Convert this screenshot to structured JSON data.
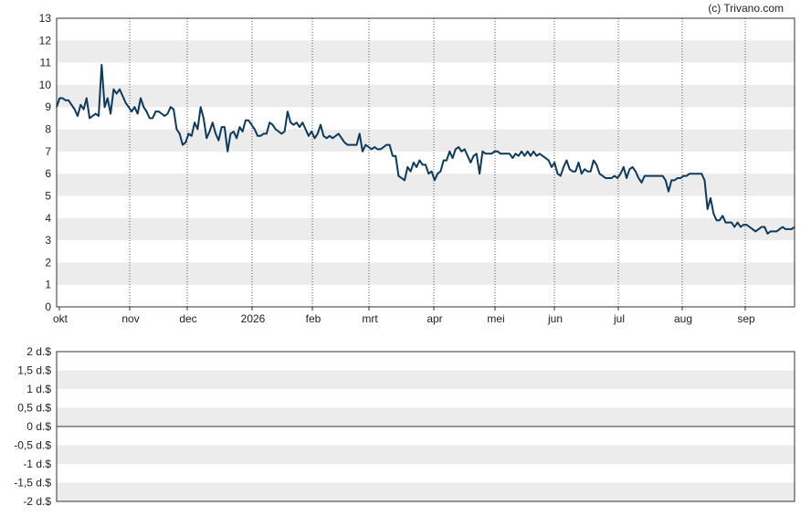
{
  "copyright": "(c) Trivano.com",
  "colors": {
    "line": "#0d3a5c",
    "band": "#ececec",
    "frame": "#333333",
    "zero_line": "#333333"
  },
  "chart_data": [
    {
      "type": "line",
      "title": "",
      "xlabel": "",
      "ylabel": "",
      "ylim": [
        0,
        13
      ],
      "yticks": [
        "0",
        "1",
        "2",
        "3",
        "4",
        "5",
        "6",
        "7",
        "8",
        "9",
        "10",
        "11",
        "12",
        "13"
      ],
      "x_ticks": [
        "okt",
        "nov",
        "dec",
        "2026",
        "feb",
        "mrt",
        "apr",
        "mei",
        "jun",
        "jul",
        "aug",
        "sep"
      ],
      "grid": "vertical dotted lines at month boundaries, alternating horizontal bands",
      "series": [
        {
          "values": [
            9.0,
            9.4,
            9.4,
            9.3,
            9.3,
            9.1,
            8.9,
            8.6,
            9.1,
            8.9,
            9.4,
            8.5,
            8.6,
            8.7,
            8.6,
            10.9,
            9.0,
            9.4,
            8.7,
            9.8,
            9.6,
            9.8,
            9.5,
            9.2,
            9.0,
            8.8,
            9.0,
            8.7,
            9.4,
            9.0,
            8.8,
            8.5,
            8.5,
            8.8,
            8.8,
            8.7,
            8.6,
            8.7,
            9.0,
            8.9,
            8.0,
            7.8,
            7.3,
            7.4,
            7.8,
            7.7,
            8.3,
            8.0,
            9.0,
            8.5,
            7.6,
            7.9,
            8.3,
            7.8,
            7.5,
            8.1,
            8.1,
            7.0,
            7.8,
            7.9,
            7.6,
            8.1,
            7.9,
            8.4,
            8.4,
            8.2,
            8.0,
            7.7,
            7.7,
            7.8,
            7.8,
            8.3,
            8.2,
            8.0,
            7.9,
            7.8,
            7.9,
            8.8,
            8.3,
            8.2,
            8.3,
            8.1,
            8.3,
            8.0,
            7.7,
            7.9,
            7.6,
            7.8,
            8.2,
            7.7,
            7.6,
            7.7,
            7.6,
            7.7,
            7.8,
            7.6,
            7.4,
            7.3,
            7.3,
            7.3,
            7.3,
            7.8,
            7.0,
            7.3,
            7.2,
            7.1,
            7.2,
            7.1,
            7.1,
            7.2,
            7.3,
            7.3,
            6.8,
            6.8,
            5.9,
            5.8,
            5.7,
            6.3,
            6.1,
            6.5,
            6.3,
            6.6,
            6.4,
            6.4,
            6.0,
            6.1,
            5.7,
            6.0,
            6.1,
            6.6,
            6.6,
            7.0,
            6.7,
            7.1,
            7.2,
            7.0,
            7.1,
            6.8,
            6.5,
            6.8,
            6.9,
            6.0,
            7.0,
            6.9,
            6.9,
            6.9,
            7.0,
            7.0,
            6.9,
            6.9,
            6.9,
            6.9,
            6.7,
            6.9,
            6.8,
            7.0,
            6.8,
            7.0,
            6.8,
            7.0,
            6.8,
            6.9,
            6.8,
            6.7,
            6.6,
            6.3,
            6.5,
            6.0,
            5.9,
            6.3,
            6.6,
            6.2,
            6.1,
            6.1,
            6.5,
            6.0,
            6.2,
            6.1,
            6.1,
            6.6,
            6.4,
            6.0,
            5.9,
            5.8,
            5.8,
            5.8,
            5.9,
            5.8,
            6.0,
            6.3,
            5.8,
            6.2,
            6.3,
            6.1,
            5.8,
            5.6,
            5.9,
            5.9,
            5.9,
            5.9,
            5.9,
            5.9,
            5.9,
            5.7,
            5.2,
            5.7,
            5.7,
            5.8,
            5.8,
            5.9,
            5.9,
            6.0,
            6.0,
            6.0,
            6.0,
            6.0,
            5.7,
            4.4,
            4.9,
            4.2,
            3.9,
            3.9,
            4.1,
            3.8,
            3.8,
            3.8,
            3.6,
            3.8,
            3.6,
            3.7,
            3.7,
            3.6,
            3.5,
            3.4,
            3.5,
            3.6,
            3.6,
            3.3,
            3.4,
            3.4,
            3.4,
            3.5,
            3.6,
            3.5,
            3.5,
            3.5,
            3.6
          ]
        }
      ]
    },
    {
      "type": "line",
      "title": "",
      "xlabel": "",
      "ylabel": "",
      "ylim": [
        -2,
        2
      ],
      "yticks": [
        "2 d.$",
        "1,5 d.$",
        "1 d.$",
        "0,5 d.$",
        "0 d.$",
        "-0,5 d.$",
        "-1 d.$",
        "-1,5 d.$",
        "-2 d.$"
      ],
      "series": []
    }
  ]
}
